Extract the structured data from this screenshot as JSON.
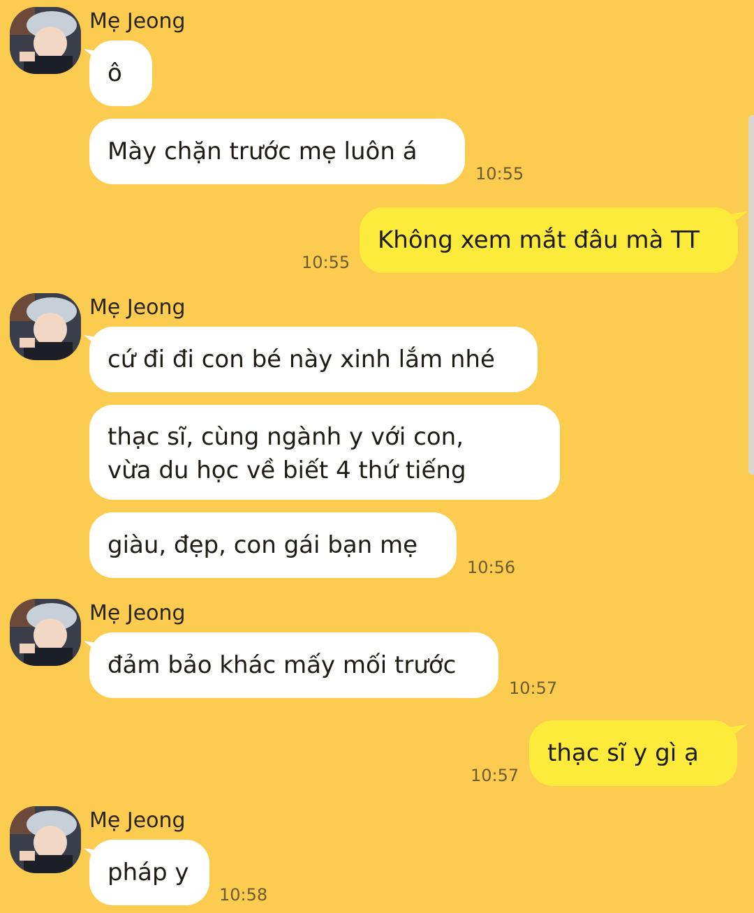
{
  "colors": {
    "background": "#fbcc4f",
    "incoming_bubble": "#ffffff",
    "outgoing_bubble": "#fdeb3c"
  },
  "messages": {
    "group1": {
      "sender": "Mẹ Jeong",
      "m1": "ô",
      "m2": "Mày chặn trước mẹ luôn á",
      "time": "10:55"
    },
    "out1": {
      "text": "Không xem mắt đâu mà TT",
      "time": "10:55"
    },
    "group2": {
      "sender": "Mẹ Jeong",
      "m1": "cứ đi đi con bé này xinh lắm nhé",
      "m2_line1": "thạc sĩ, cùng ngành y với con,",
      "m2_line2": "vừa du học về biết 4 thứ tiếng",
      "m3": "giàu, đẹp, con gái bạn mẹ",
      "time": "10:56"
    },
    "group3": {
      "sender": "Mẹ Jeong",
      "m1": "đảm bảo khác mấy mối trước",
      "time": "10:57"
    },
    "out2": {
      "text": "thạc sĩ y gì ạ",
      "time": "10:57"
    },
    "group4": {
      "sender": "Mẹ Jeong",
      "m1": "pháp y",
      "time": "10:58"
    }
  },
  "icons": {
    "avatar": "contact-avatar-icon"
  }
}
